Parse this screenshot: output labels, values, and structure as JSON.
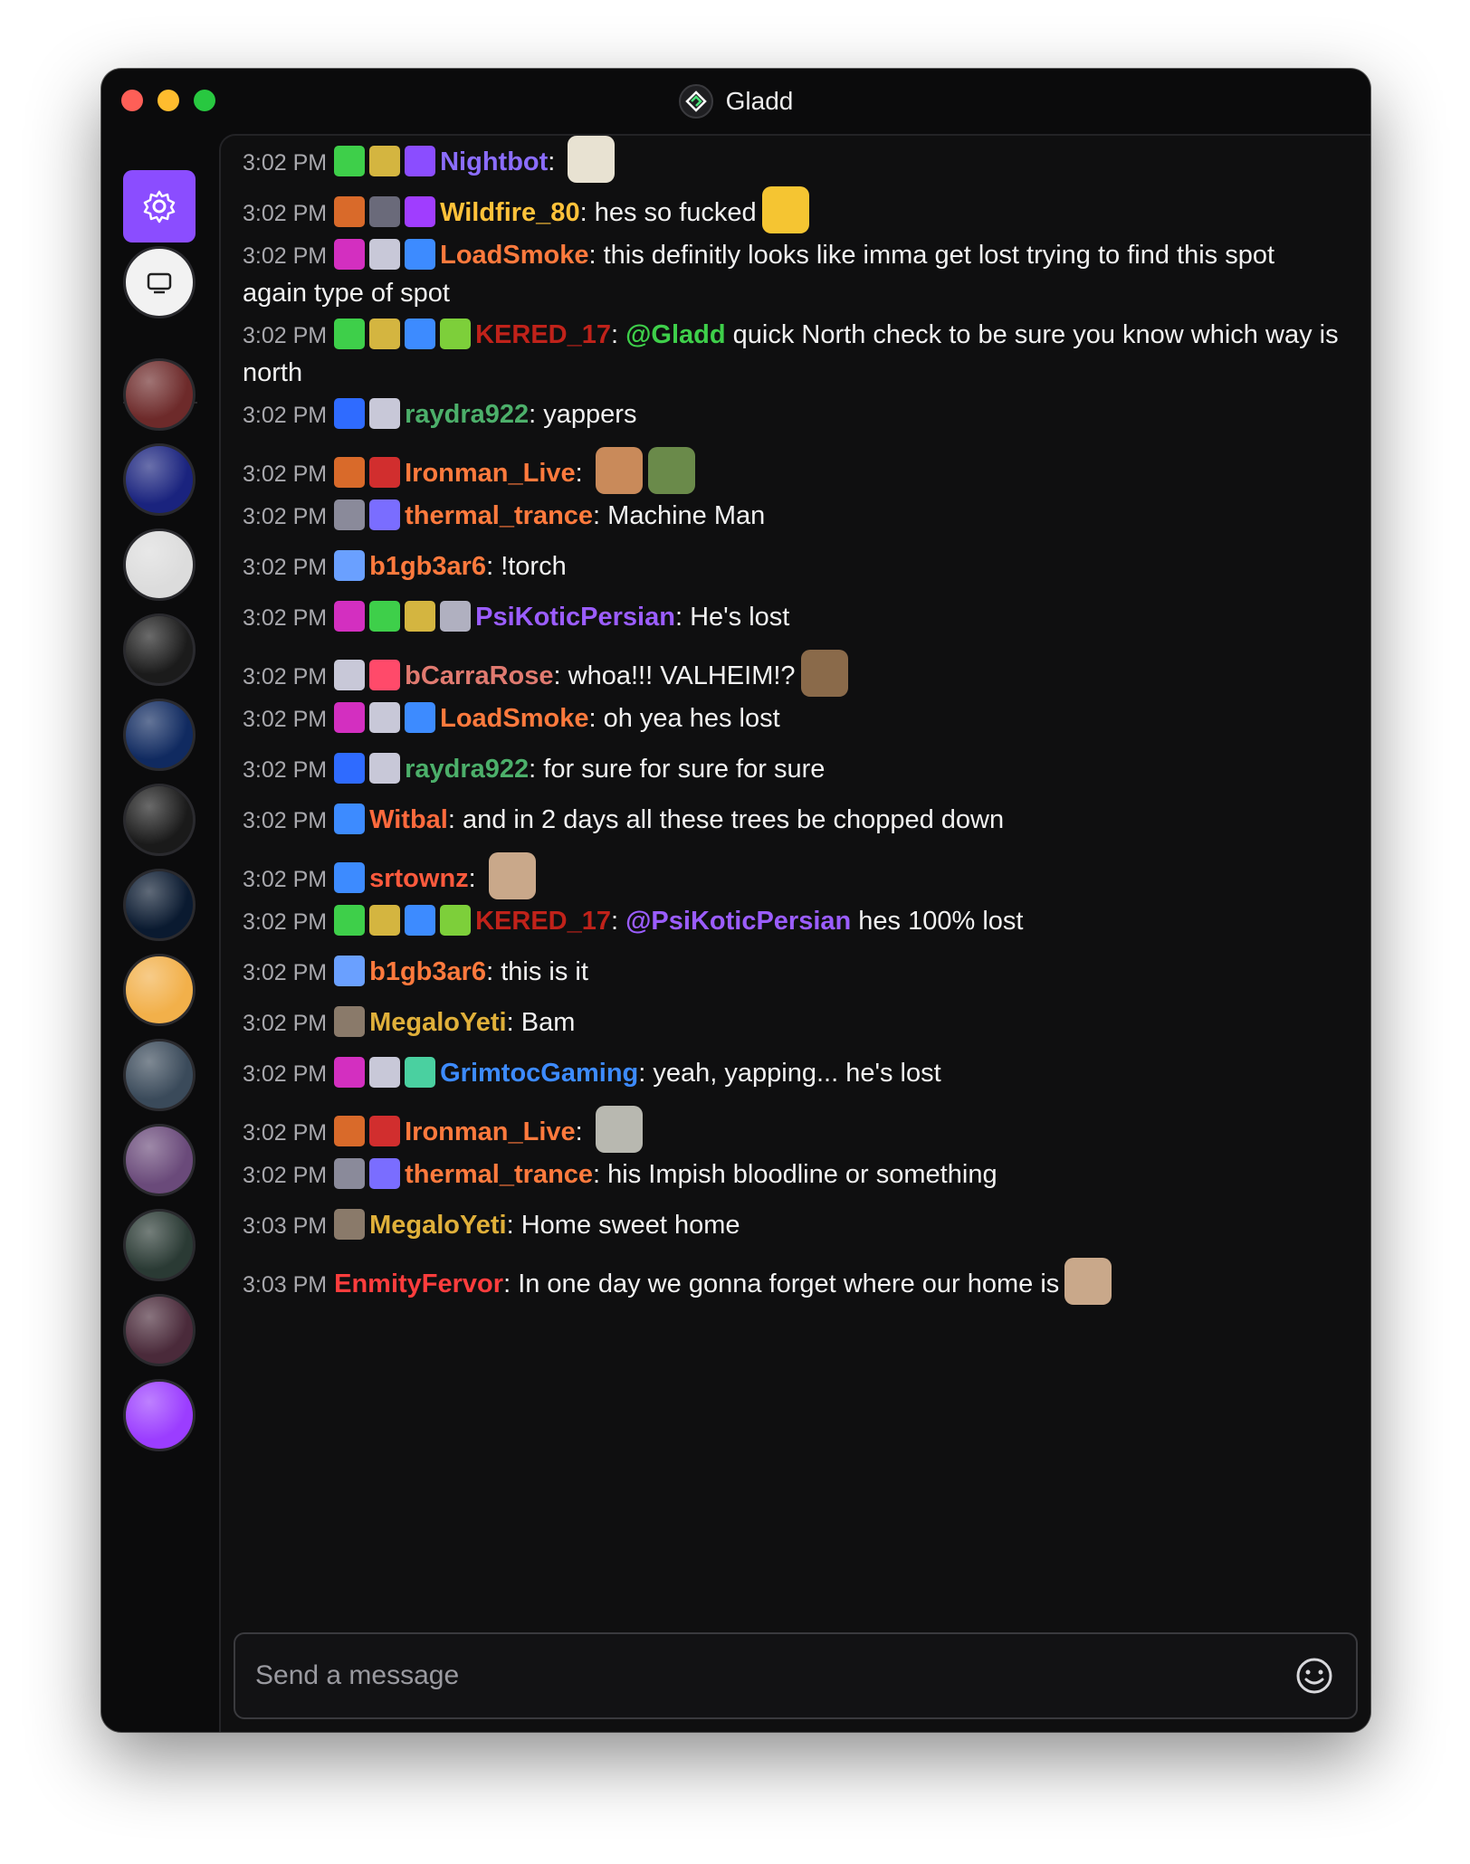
{
  "window": {
    "title": "Gladd"
  },
  "sidebar": {
    "channels": [
      {
        "name": "settings",
        "icon": "gear-icon",
        "color": "#8b4dff"
      },
      {
        "name": "channel-1",
        "color": "#f2f2f2"
      },
      {
        "name": "channel-2",
        "color": "#6d2a2a"
      },
      {
        "name": "channel-3",
        "color": "#1a237e"
      },
      {
        "name": "channel-4",
        "color": "#dcdcdc"
      },
      {
        "name": "channel-5",
        "color": "#1b1b1b"
      },
      {
        "name": "channel-6",
        "color": "#102a60"
      },
      {
        "name": "channel-7",
        "color": "#1a1a1a"
      },
      {
        "name": "channel-8",
        "color": "#0a1a30"
      },
      {
        "name": "channel-9",
        "color": "#f2b04a"
      },
      {
        "name": "channel-10",
        "color": "#3a4a5a"
      },
      {
        "name": "channel-11",
        "color": "#6a4a7a"
      },
      {
        "name": "channel-12",
        "color": "#2a3a34"
      },
      {
        "name": "channel-13",
        "color": "#4a2a3a"
      },
      {
        "name": "channel-14",
        "color": "#9b3dff"
      }
    ]
  },
  "messages": [
    {
      "time": "3:02 PM",
      "badges": [
        "#3ecf4a",
        "#d4b540",
        "#8b4dff"
      ],
      "user": "Nightbot",
      "color": "#8b6dff",
      "text": "",
      "emotes": [
        "#e8e2d2"
      ]
    },
    {
      "time": "3:02 PM",
      "badges": [
        "#d96a2a",
        "#6a6a7a",
        "#a03dff"
      ],
      "user": "Wildfire_80",
      "color": "#ffc23a",
      "text": "hes so fucked",
      "emotes": [
        "#f5c532"
      ]
    },
    {
      "time": "3:02 PM",
      "badges": [
        "#d32fc0",
        "#c8c8d8",
        "#3d8bff"
      ],
      "user": "LoadSmoke",
      "color": "#ff7a3d",
      "text": "this definitly looks like imma get lost trying to find this spot again type of spot",
      "emotes": []
    },
    {
      "time": "3:02 PM",
      "badges": [
        "#3ecf4a",
        "#d4b540",
        "#3d8bff",
        "#7dcf3a"
      ],
      "user": "KERED_17",
      "color": "#c0221a",
      "mention": "@Gladd",
      "mention_color": "#3ecf4a",
      "text": "quick North check to be sure you know which way is north",
      "emotes": []
    },
    {
      "time": "3:02 PM",
      "badges": [
        "#2f6bff",
        "#c8c8d8"
      ],
      "user": "raydra922",
      "color": "#4caf6a",
      "text": "yappers",
      "emotes": []
    },
    {
      "time": "3:02 PM",
      "badges": [
        "#d96a2a",
        "#d12e2e"
      ],
      "user": "Ironman_Live",
      "color": "#ff7a3d",
      "text": "",
      "emotes": [
        "#c98a5a",
        "#6a8a4a"
      ]
    },
    {
      "time": "3:02 PM",
      "badges": [
        "#8a8a9a",
        "#7a6dff"
      ],
      "user": "thermal_trance",
      "color": "#ff7a3d",
      "text": "Machine Man",
      "emotes": []
    },
    {
      "time": "3:02 PM",
      "badges": [
        "#6aa0ff"
      ],
      "user": "b1gb3ar6",
      "color": "#ff7a3d",
      "text": "!torch",
      "emotes": []
    },
    {
      "time": "3:02 PM",
      "badges": [
        "#d32fc0",
        "#3ecf4a",
        "#d4b540",
        "#b0b0c0"
      ],
      "user": "PsiKoticPersian",
      "color": "#9b5dff",
      "text": "He's lost",
      "emotes": []
    },
    {
      "time": "3:02 PM",
      "badges": [
        "#c8c8d8",
        "#ff4a6a"
      ],
      "user": "bCarraRose",
      "color": "#e07a70",
      "text": "whoa!!! VALHEIM!?",
      "emotes": [
        "#8a6a4a"
      ]
    },
    {
      "time": "3:02 PM",
      "badges": [
        "#d32fc0",
        "#c8c8d8",
        "#3d8bff"
      ],
      "user": "LoadSmoke",
      "color": "#ff7a3d",
      "text": "oh yea hes lost",
      "emotes": []
    },
    {
      "time": "3:02 PM",
      "badges": [
        "#2f6bff",
        "#c8c8d8"
      ],
      "user": "raydra922",
      "color": "#4caf6a",
      "text": "for sure for sure for sure",
      "emotes": []
    },
    {
      "time": "3:02 PM",
      "badges": [
        "#3d8bff"
      ],
      "user": "Witbal",
      "color": "#ff6a3d",
      "text": "and in 2 days all these trees be chopped down",
      "emotes": []
    },
    {
      "time": "3:02 PM",
      "badges": [
        "#3d8bff"
      ],
      "user": "srtownz",
      "color": "#ff5a3d",
      "text": "",
      "emotes": [
        "#c9a88a"
      ]
    },
    {
      "time": "3:02 PM",
      "badges": [
        "#3ecf4a",
        "#d4b540",
        "#3d8bff",
        "#7dcf3a"
      ],
      "user": "KERED_17",
      "color": "#c0221a",
      "mention": "@PsiKoticPersian",
      "mention_color": "#9b5dff",
      "text": "hes 100% lost",
      "emotes": []
    },
    {
      "time": "3:02 PM",
      "badges": [
        "#6aa0ff"
      ],
      "user": "b1gb3ar6",
      "color": "#ff7a3d",
      "text": "this is it",
      "emotes": []
    },
    {
      "time": "3:02 PM",
      "badges": [
        "#8a7a6a"
      ],
      "user": "MegaloYeti",
      "color": "#e0b03a",
      "text": "Bam",
      "emotes": []
    },
    {
      "time": "3:02 PM",
      "badges": [
        "#d32fc0",
        "#c8c8d8",
        "#4ad0a0"
      ],
      "user": "GrimtocGaming",
      "color": "#3d8bff",
      "text": "yeah, yapping... he's lost",
      "emotes": []
    },
    {
      "time": "3:02 PM",
      "badges": [
        "#d96a2a",
        "#d12e2e"
      ],
      "user": "Ironman_Live",
      "color": "#ff7a3d",
      "text": "",
      "emotes": [
        "#b8b8b0"
      ]
    },
    {
      "time": "3:02 PM",
      "badges": [
        "#8a8a9a",
        "#7a6dff"
      ],
      "user": "thermal_trance",
      "color": "#ff7a3d",
      "text": "his Impish bloodline or something",
      "emotes": []
    },
    {
      "time": "3:03 PM",
      "badges": [
        "#8a7a6a"
      ],
      "user": "MegaloYeti",
      "color": "#e0b03a",
      "text": "Home sweet home",
      "emotes": []
    },
    {
      "time": "3:03 PM",
      "badges": [],
      "user": "EnmityFervor",
      "color": "#ff3d3d",
      "text": "In one day we gonna forget where our home is",
      "emotes": [
        "#c9a88a"
      ]
    }
  ],
  "composer": {
    "placeholder": "Send a message",
    "emoji_icon": "smiley-icon"
  }
}
